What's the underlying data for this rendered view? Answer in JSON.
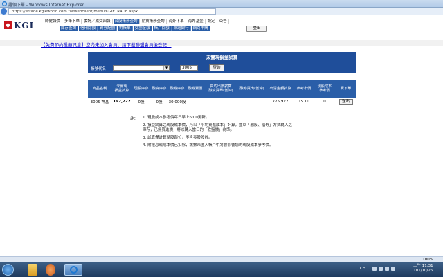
{
  "window": {
    "title": "證個下單 - Windows Internet Explorer",
    "url": "https://etrade.kgieworld.com.tw/webclient/menu/KGIETRADE.aspx"
  },
  "logo": {
    "text": "KGI"
  },
  "menu": {
    "row1": [
      "師健報價",
      "多筆下單",
      "委託／成交回報",
      "台股帳務查詢",
      "期貨帳務查詢",
      "海外下單",
      "海外基金",
      "設定",
      "公告"
    ],
    "row1_active_index": 3,
    "row2": [
      "庫存查詢",
      "信用餘額",
      "資券配額",
      "對帳單",
      "交割金額",
      "帳戶餘額",
      "網路銀行",
      "網路申購"
    ]
  },
  "logout_label": "登出",
  "promo_text": "【免費節約投顧訊息】您尚未加入會員，請下載聯盟會員後登記！",
  "panel": {
    "title": "未實現損益試算",
    "stock_label": "帳號代名：",
    "stock_code": "3005",
    "query_label": "查詢"
  },
  "table": {
    "headers": [
      "商品名稱",
      "未實現\n損益試算",
      "現股庫存",
      "融資庫存",
      "融券庫存",
      "融券賣價",
      "買均出價試算\n融資買單(當沖)",
      "融券買出(當沖)",
      "出清金額試算",
      "參考市價",
      "現股成本\n參考價",
      "賣下單"
    ],
    "row": {
      "name": "3005 神基",
      "pnl": "192,222",
      "spot": "0股",
      "margin": "0股",
      "short": "30,000股",
      "total": "775,922",
      "price": "15.10",
      "cost": "0",
      "sell": "送出"
    }
  },
  "notes": {
    "lead": "註：",
    "items": [
      "1. 現股成本參考價每日早上6:00更新。",
      "2. 損益試算之現股成本價，乃以「平均買進成本」計算，並以「融股、借券」方式轉入之",
      "    庫存，已無買進價，將以轉入當日的「收盤價」為準。",
      "3. 試算僅計算整股部位，不含零股股數。",
      "4. 附權息或成本價已扣除，該數未匯入帳戶中將會影響您的現股成本參考價。"
    ]
  },
  "status": {
    "zoom": "100%"
  },
  "taskbar": {
    "lang": "CH",
    "time": "上午 11:31",
    "date": "101/10/26"
  }
}
